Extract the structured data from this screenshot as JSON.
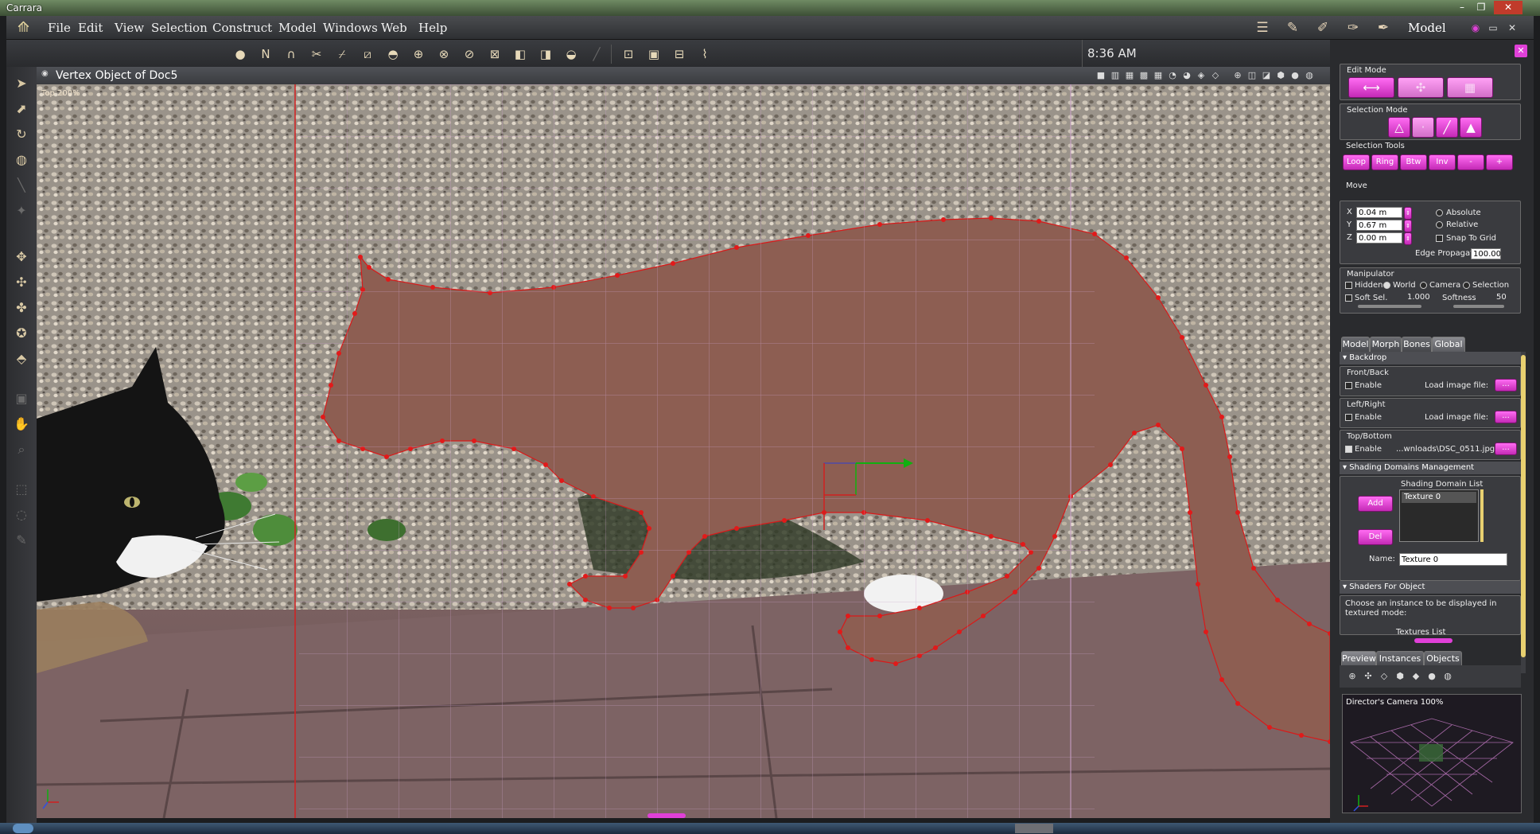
{
  "window": {
    "title": "Carrara"
  },
  "menubar": {
    "items": [
      "File",
      "Edit",
      "View",
      "Selection",
      "Construct",
      "Model",
      "Windows",
      "Web",
      "Help"
    ],
    "room": "Model"
  },
  "toolbar": {
    "clock": "8:36 AM"
  },
  "viewport": {
    "title": "Vertex Object of Doc5",
    "view_label": "Top 200%"
  },
  "panel": {
    "edit_mode": "Edit Mode",
    "selection_mode": "Selection Mode",
    "selection_tools": {
      "title": "Selection Tools",
      "buttons": [
        "Loop",
        "Ring",
        "Btw",
        "Inv",
        "-",
        "+"
      ]
    },
    "move": {
      "title": "Move",
      "x": "0.04 m",
      "y": "0.67 m",
      "z": "0.00 m",
      "x_label": "X",
      "y_label": "Y",
      "z_label": "Z",
      "absolute": "Absolute",
      "relative": "Relative",
      "snap": "Snap To Grid",
      "edge_propagation_label": "Edge Propagation",
      "edge_propagation": "100.00"
    },
    "manipulator": {
      "title": "Manipulator",
      "options": [
        "Hidden",
        "World",
        "Camera",
        "Selection"
      ],
      "soft_sel": "Soft Sel.",
      "soft_val": "1.000",
      "softness": "Softness",
      "softness_val": "50"
    },
    "tabs": [
      "Model",
      "Morph",
      "Bones",
      "Global"
    ],
    "backdrop": {
      "header": "Backdrop",
      "front_back": "Front/Back",
      "left_right": "Left/Right",
      "top_bottom": "Top/Bottom",
      "enable": "Enable",
      "load_image": "Load image file:",
      "top_file": "...wnloads\\DSC_0511.jpg",
      "btn": "..."
    },
    "shading": {
      "header": "Shading Domains Management",
      "list_title": "Shading Domain List",
      "add": "Add",
      "del": "Del",
      "item": "Texture 0",
      "name_label": "Name:",
      "name_value": "Texture 0"
    },
    "shaders": {
      "header": "Shaders For Object",
      "desc": "Choose an instance to be displayed in textured mode:",
      "list": "Textures List"
    },
    "bottom_tabs": [
      "Preview",
      "Instances",
      "Objects"
    ],
    "preview_label": "Director's Camera 100%"
  },
  "colors": {
    "accent": "#e040d8",
    "shape": "#8d5e52",
    "vertex": "#e11a1a"
  }
}
